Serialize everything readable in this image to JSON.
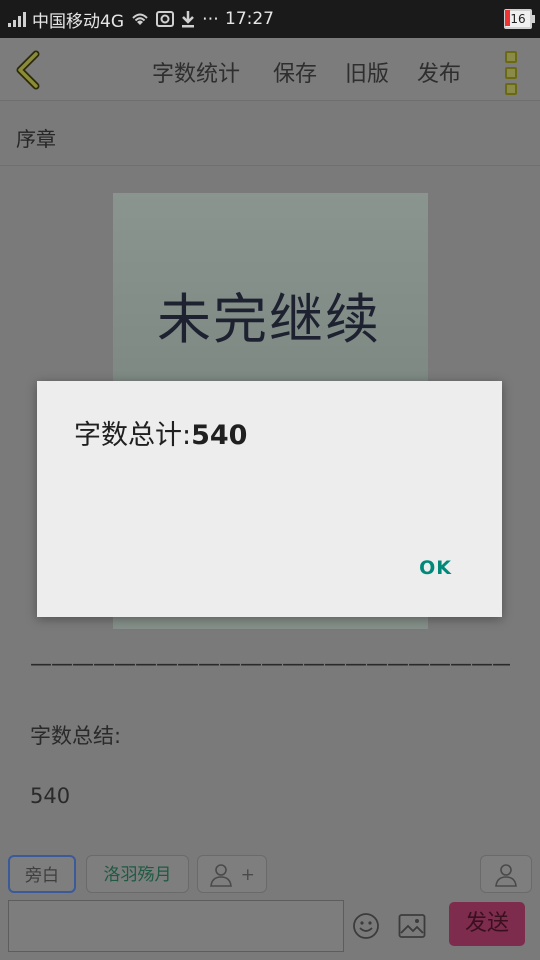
{
  "status_bar": {
    "carrier": "中国移动4G",
    "time": "17:27",
    "battery": "16"
  },
  "toolbar": {
    "word_count_label": "字数统计",
    "save_label": "保存",
    "old_version_label": "旧版",
    "publish_label": "发布"
  },
  "chapter": {
    "title": "序章"
  },
  "cover": {
    "text": "未完继续"
  },
  "content": {
    "divider": "——————————————————————————",
    "summary_label": "字数总结:",
    "summary_value": "540"
  },
  "bottom": {
    "narration_chip": "旁白",
    "character_chip": "洛羽殇月",
    "add_symbol": "+",
    "send_label": "发送"
  },
  "dialog": {
    "prefix": "字数总计:",
    "count": "540",
    "ok_label": "OK"
  },
  "colors": {
    "dialog_ok": "#00897b",
    "send_button": "#7d2c4e"
  }
}
